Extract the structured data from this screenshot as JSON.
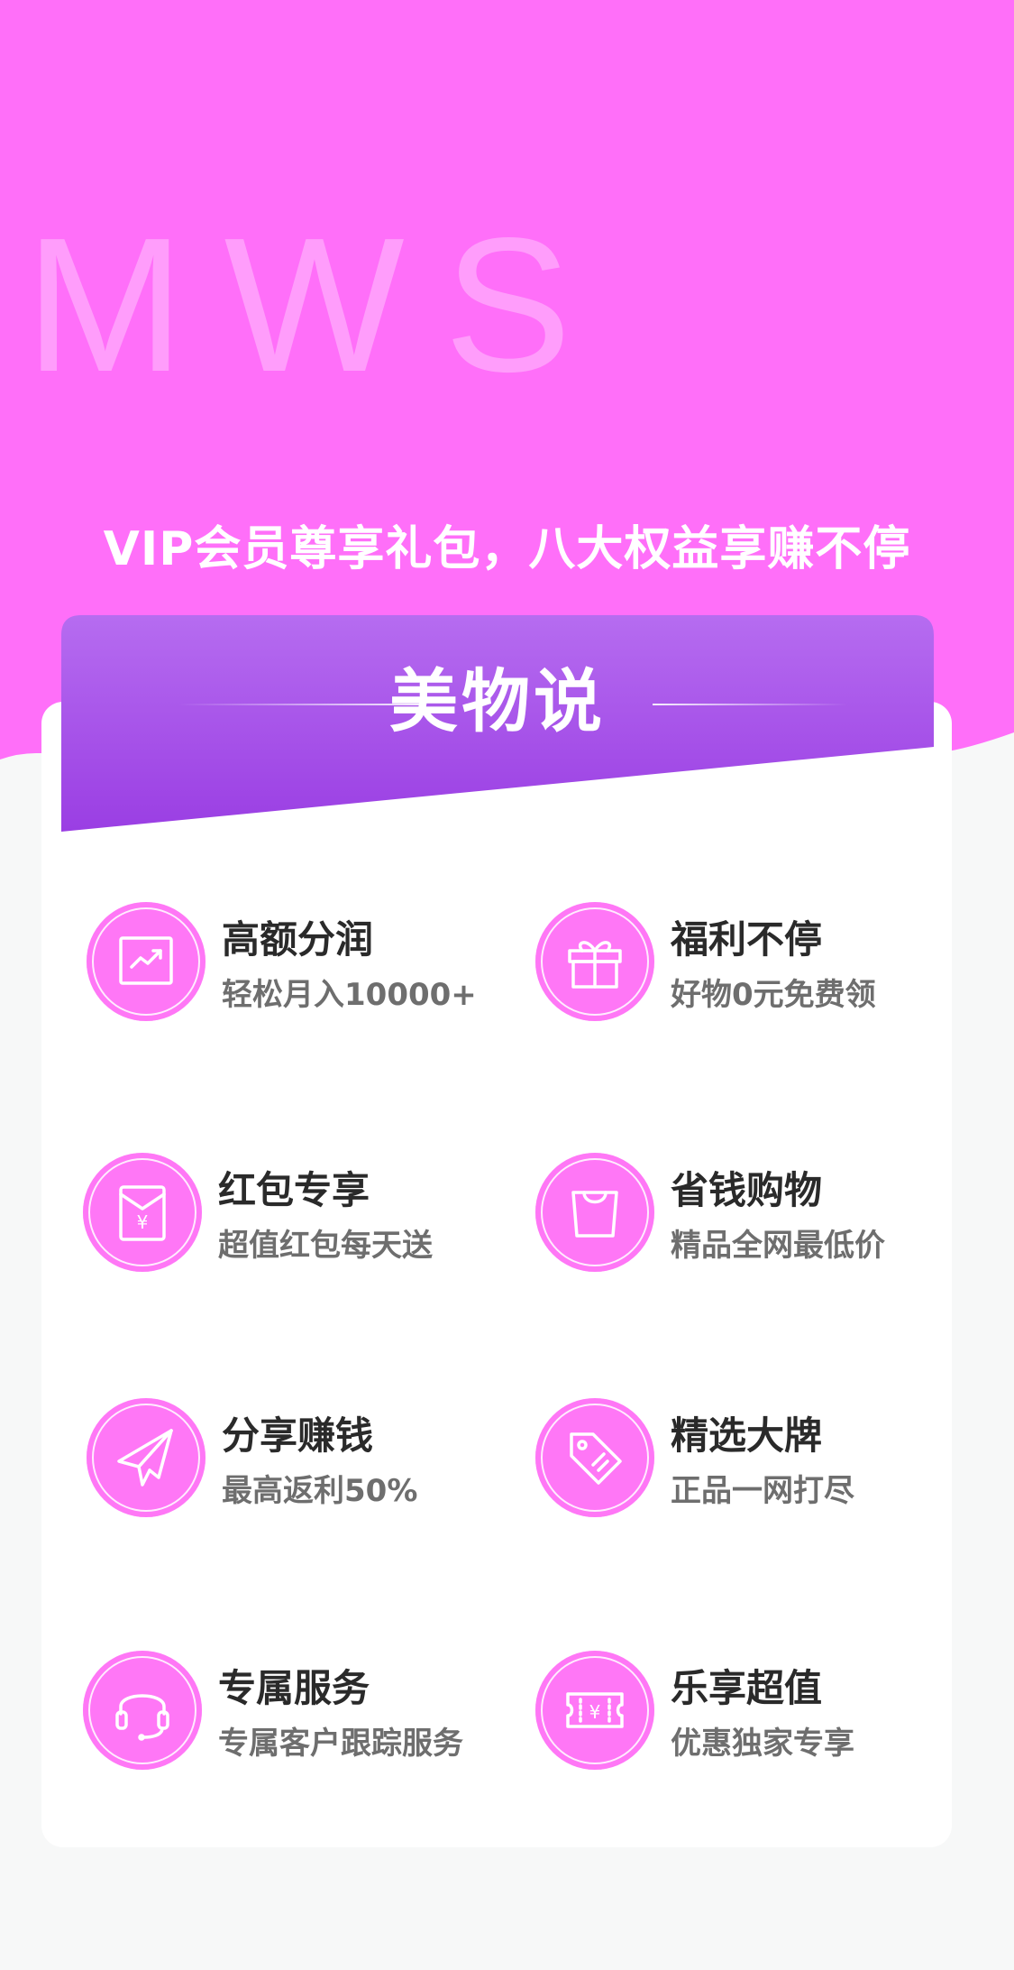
{
  "hero": {
    "watermark": "MWS",
    "slogan": "VIP会员尊享礼包，八大权益享赚不停",
    "bg_color": "#ff6ff9"
  },
  "card": {
    "title": "美物说",
    "header_gradient": [
      "#b66cf0",
      "#9a3ee3"
    ]
  },
  "benefits": [
    {
      "title": "高额分润",
      "desc": "轻松月入10000+",
      "icon": "trend-chart-icon"
    },
    {
      "title": "福利不停",
      "desc": "好物0元免费领",
      "icon": "gift-icon"
    },
    {
      "title": "红包专享",
      "desc": "超值红包每天送",
      "icon": "red-envelope-icon"
    },
    {
      "title": "省钱购物",
      "desc": "精品全网最低价",
      "icon": "shopping-bag-icon"
    },
    {
      "title": "分享赚钱",
      "desc": "最高返利50%",
      "icon": "paper-plane-icon"
    },
    {
      "title": "精选大牌",
      "desc": "正品一网打尽",
      "icon": "price-tag-icon"
    },
    {
      "title": "专属服务",
      "desc": "专属客户跟踪服务",
      "icon": "headset-icon"
    },
    {
      "title": "乐享超值",
      "desc": "优惠独家专享",
      "icon": "coupon-icon"
    }
  ],
  "colors": {
    "accent": "#ff77f6",
    "title_text": "#2a2a2a",
    "desc_text": "#6e6e6e",
    "page_bg": "#f7f8f8"
  }
}
